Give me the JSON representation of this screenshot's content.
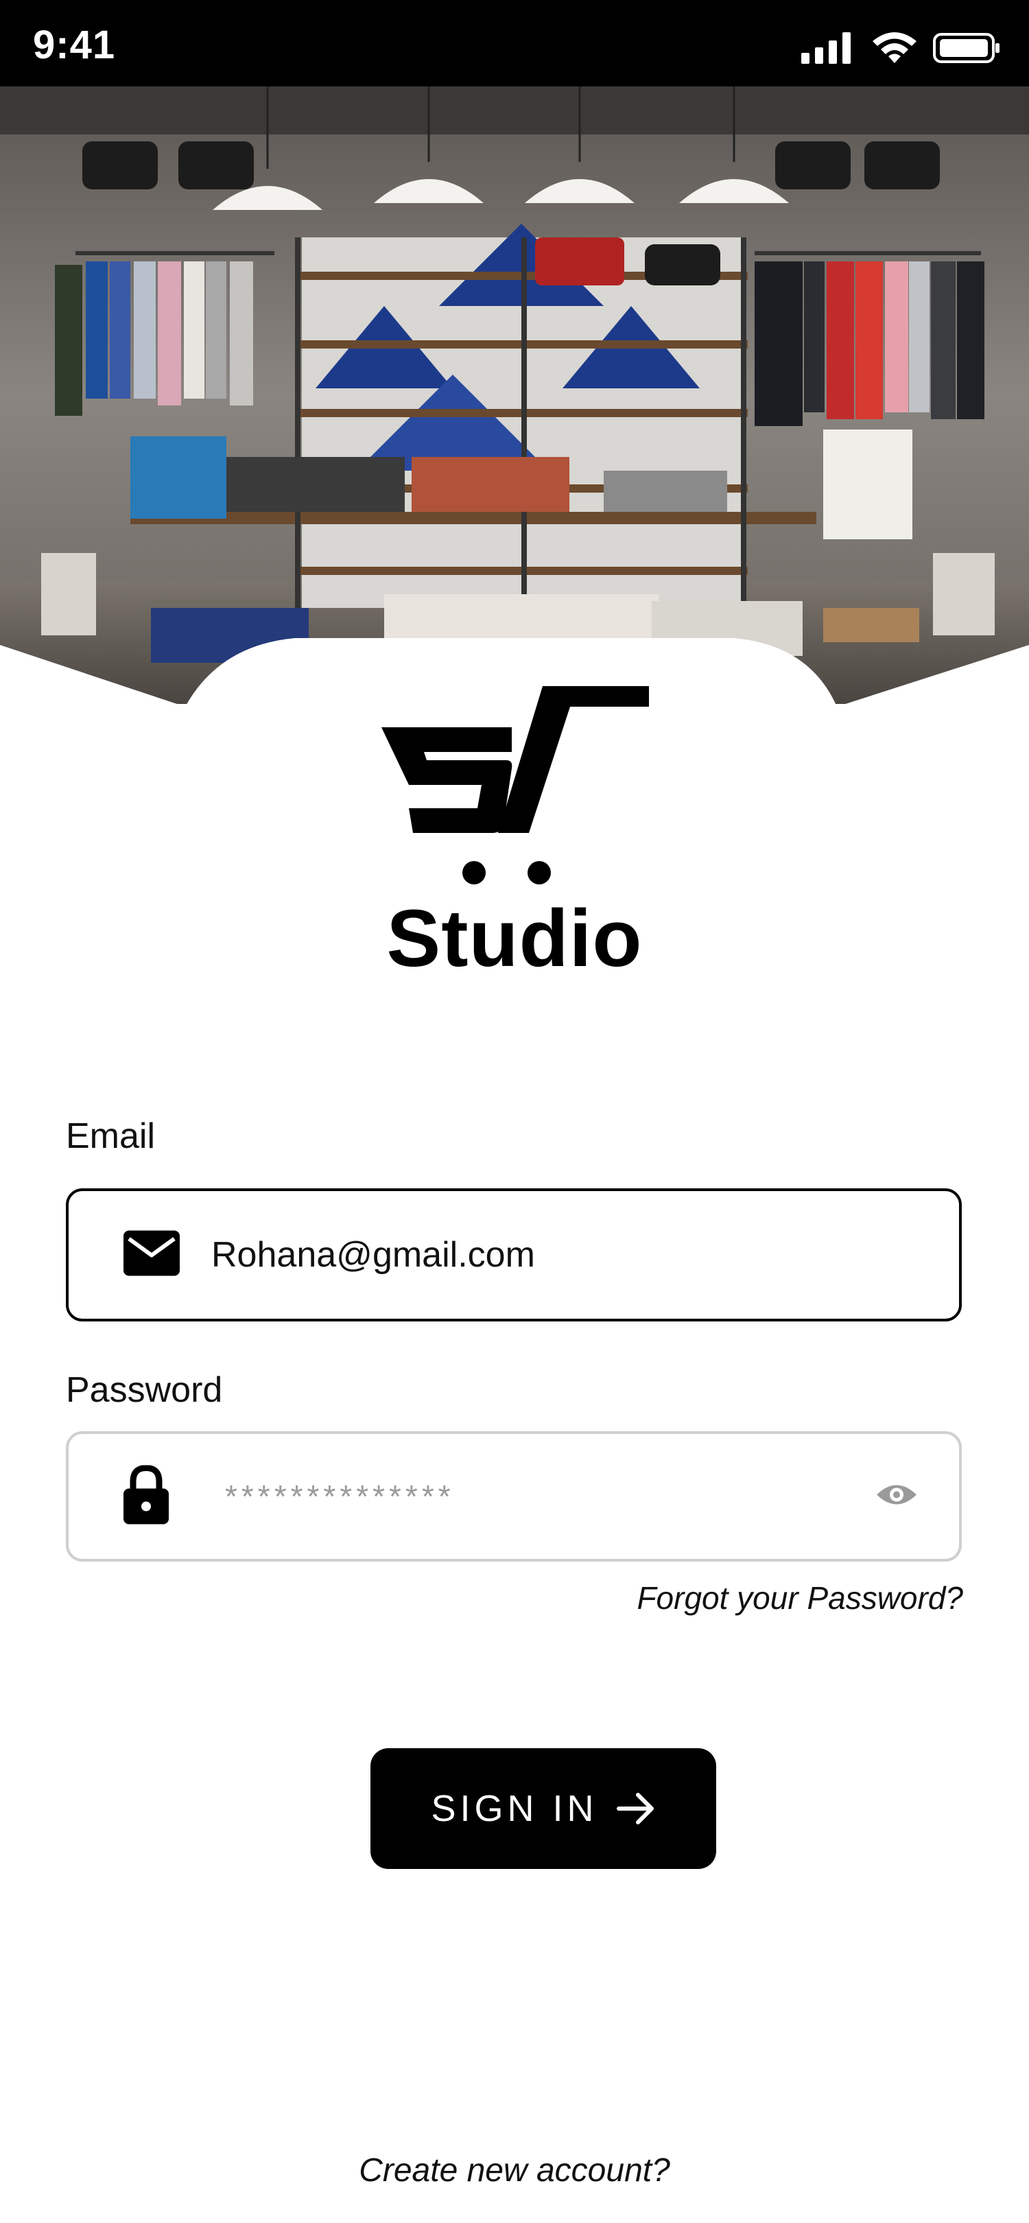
{
  "status_bar": {
    "time": "9:41",
    "icons": [
      "cellular-signal-icon",
      "wifi-icon",
      "battery-icon"
    ]
  },
  "hero": {
    "description_icon": "store-interior-photo"
  },
  "brand": {
    "name": "Studio",
    "logo_icon": "shopping-cart-logo-icon"
  },
  "form": {
    "email_label": "Email",
    "email_value": "Rohana@gmail.com",
    "email_icon": "mail-icon",
    "password_label": "Password",
    "password_value": "**************",
    "password_icon": "lock-icon",
    "toggle_icon": "eye-icon",
    "forgot_label": "Forgot your Password?"
  },
  "actions": {
    "signin_label": "SIGN IN",
    "signin_icon": "arrow-right-icon",
    "create_account_label": "Create new account?"
  },
  "colors": {
    "primary": "#000000",
    "background": "#ffffff",
    "placeholder": "#9a9a9a",
    "border_inactive": "#cfcfcf"
  }
}
